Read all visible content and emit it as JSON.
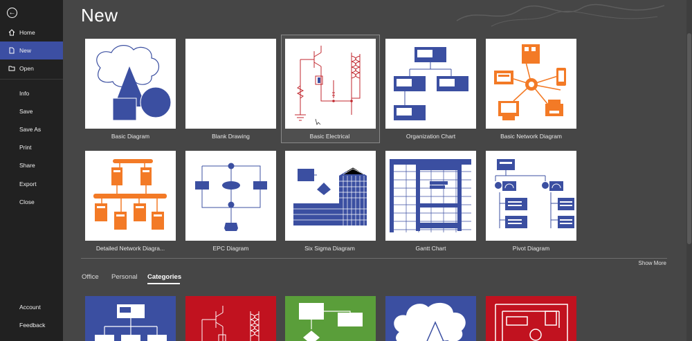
{
  "sidebar": {
    "back_label": "←",
    "items": [
      {
        "label": "Home",
        "icon": "home-icon"
      },
      {
        "label": "New",
        "icon": "new-document-icon"
      },
      {
        "label": "Open",
        "icon": "folder-open-icon"
      },
      {
        "label": "Info"
      },
      {
        "label": "Save"
      },
      {
        "label": "Save As"
      },
      {
        "label": "Print"
      },
      {
        "label": "Share"
      },
      {
        "label": "Export"
      },
      {
        "label": "Close"
      }
    ],
    "bottom": [
      {
        "label": "Account"
      },
      {
        "label": "Feedback"
      }
    ]
  },
  "page_title": "New",
  "templates": [
    {
      "label": "Basic Diagram"
    },
    {
      "label": "Blank Drawing"
    },
    {
      "label": "Basic Electrical"
    },
    {
      "label": "Organization Chart"
    },
    {
      "label": "Basic Network Diagram"
    },
    {
      "label": "Detailed Network Diagra..."
    },
    {
      "label": "EPC Diagram"
    },
    {
      "label": "Six Sigma Diagram"
    },
    {
      "label": "Gantt Chart"
    },
    {
      "label": "Pivot Diagram"
    }
  ],
  "show_more": "Show More",
  "tabs": [
    {
      "label": "Office"
    },
    {
      "label": "Personal"
    },
    {
      "label": "Categories"
    }
  ],
  "colors": {
    "sidebar_bg": "#212121",
    "active_nav": "#3c4fa3",
    "main_bg": "#464646",
    "diagram_blue": "#3b4fa1",
    "network_orange": "#f37a26",
    "electrical_red": "#c0262d",
    "cat_green": "#5a9e3a",
    "cat_red": "#c1121f"
  }
}
